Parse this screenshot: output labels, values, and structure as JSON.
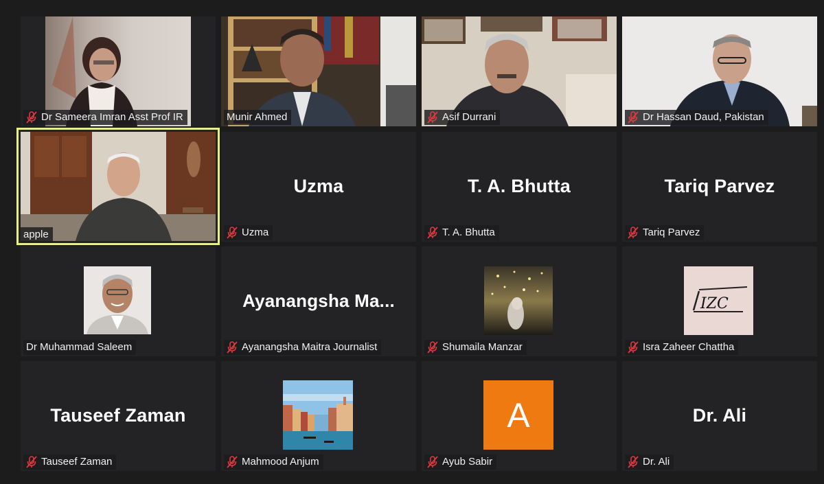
{
  "tiles": [
    {
      "name": "Dr Sameera Imran Asst Prof IR",
      "muted": true,
      "kind": "video"
    },
    {
      "name": "Munir Ahmed",
      "muted": false,
      "kind": "video"
    },
    {
      "name": "Asif Durrani",
      "muted": true,
      "kind": "video"
    },
    {
      "name": "Dr Hassan Daud, Pakistan",
      "muted": true,
      "kind": "video"
    },
    {
      "name": "apple",
      "muted": false,
      "kind": "video",
      "active_speaker": true
    },
    {
      "name": "Uzma",
      "muted": true,
      "kind": "name",
      "display": "Uzma"
    },
    {
      "name": "T. A. Bhutta",
      "muted": true,
      "kind": "name",
      "display": "T. A. Bhutta"
    },
    {
      "name": "Tariq Parvez",
      "muted": true,
      "kind": "name",
      "display": "Tariq Parvez"
    },
    {
      "name": "Dr Muhammad Saleem",
      "muted": false,
      "kind": "avatar",
      "avatar": "portrait-photo"
    },
    {
      "name": "Ayanangsha Maitra Journalist",
      "muted": true,
      "kind": "name",
      "display": "Ayanangsha  Ma..."
    },
    {
      "name": "Shumaila Manzar",
      "muted": true,
      "kind": "avatar",
      "avatar": "sparkle-photo"
    },
    {
      "name": "Isra Zaheer Chattha",
      "muted": true,
      "kind": "avatar",
      "avatar": "logo",
      "logo_text": "IZC"
    },
    {
      "name": "Tauseef Zaman",
      "muted": true,
      "kind": "name",
      "display": "Tauseef Zaman"
    },
    {
      "name": "Mahmood Anjum",
      "muted": true,
      "kind": "avatar",
      "avatar": "venice-photo"
    },
    {
      "name": "Ayub Sabir",
      "muted": true,
      "kind": "avatar",
      "avatar": "letter",
      "letter": "A",
      "color": "#f07a12"
    },
    {
      "name": "Dr. Ali",
      "muted": true,
      "kind": "name",
      "display": "Dr. Ali"
    }
  ],
  "colors": {
    "background": "#1c1c1d",
    "tile": "#232326",
    "active_border": "#e8ee8a",
    "muted_icon": "#e0393e"
  }
}
